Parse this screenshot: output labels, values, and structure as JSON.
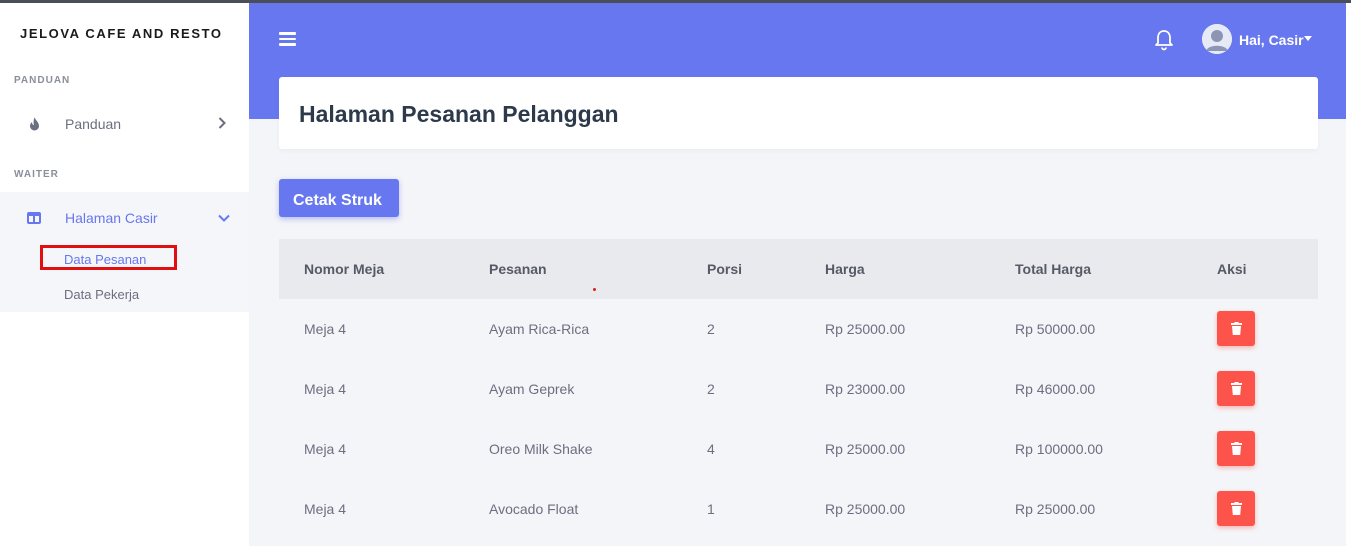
{
  "sidebar": {
    "brand": "JELOVA CAFE AND RESTO",
    "sections": [
      {
        "label": "PANDUAN"
      },
      {
        "label": "WAITER"
      }
    ],
    "items": [
      {
        "label": "Panduan",
        "icon": "fire-icon"
      },
      {
        "label": "Halaman Casir",
        "icon": "columns-icon",
        "active": true
      }
    ],
    "subitems": [
      {
        "label": "Data Pesanan",
        "active": true
      },
      {
        "label": "Data Pekerja"
      }
    ]
  },
  "topbar": {
    "user_greeting": "Hai, Casir",
    "icons": [
      "menu-icon",
      "bell-icon",
      "avatar"
    ]
  },
  "page": {
    "title": "Halaman Pesanan Pelanggan",
    "print_button": "Cetak Struk"
  },
  "table": {
    "headers": [
      "Nomor Meja",
      "Pesanan",
      "Porsi",
      "Harga",
      "Total Harga",
      "Aksi"
    ],
    "rows": [
      [
        "Meja 4",
        "Ayam Rica-Rica",
        "2",
        "Rp 25000.00",
        "Rp 50000.00"
      ],
      [
        "Meja 4",
        "Ayam Geprek",
        "2",
        "Rp 23000.00",
        "Rp 46000.00"
      ],
      [
        "Meja 4",
        "Oreo Milk Shake",
        "4",
        "Rp 25000.00",
        "Rp 100000.00"
      ],
      [
        "Meja 4",
        "Avocado Float",
        "1",
        "Rp 25000.00",
        "Rp 25000.00"
      ]
    ]
  },
  "colors": {
    "primary": "#6777ef",
    "danger": "#fc544b",
    "highlight": "#e01010"
  }
}
